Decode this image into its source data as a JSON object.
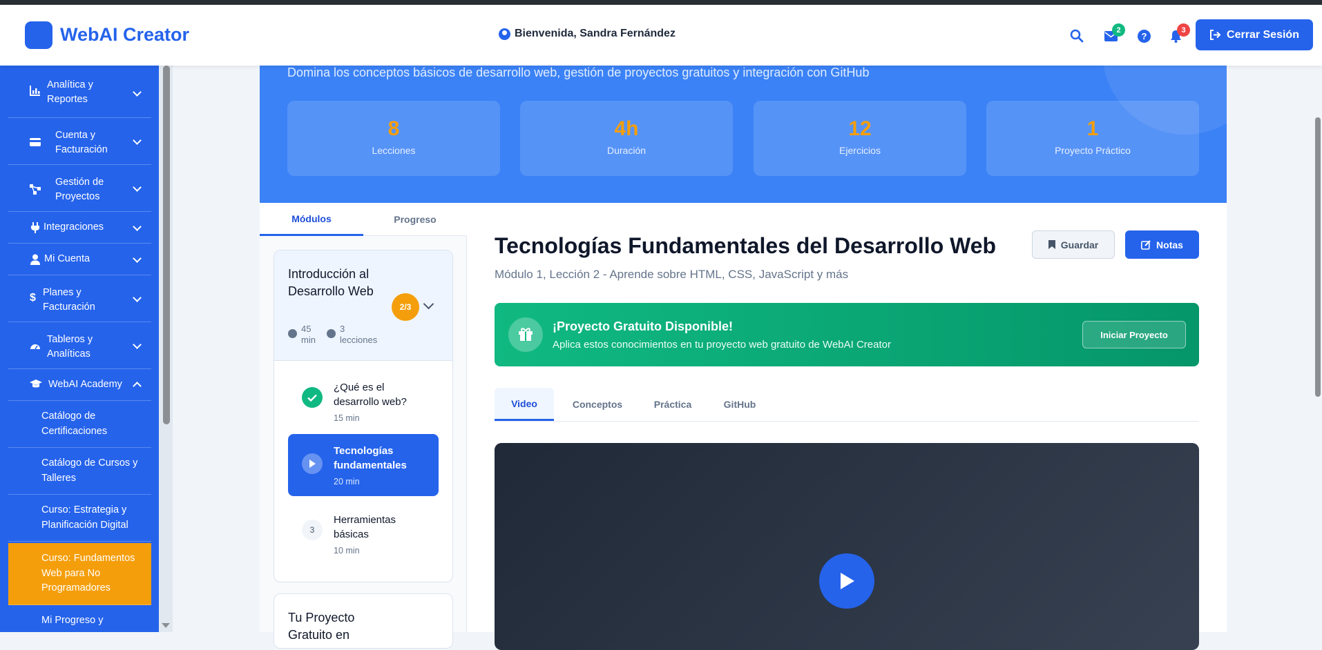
{
  "header": {
    "app_name": "WebAI Creator",
    "welcome": "Bienvenida, Sandra Fernández",
    "messages_count": "2",
    "notifications_count": "3",
    "logout_label": "Cerrar Sesión"
  },
  "sidebar": {
    "items": [
      {
        "label": "Analítica y Reportes",
        "icon": "chart-icon"
      },
      {
        "label": "Cuenta y Facturación",
        "icon": "credit-card-icon"
      },
      {
        "label": "Gestión de Proyectos",
        "icon": "project-diagram-icon"
      },
      {
        "label": "Integraciones",
        "icon": "plug-icon"
      },
      {
        "label": "Mi Cuenta",
        "icon": "user-icon"
      },
      {
        "label": "Planes y Facturación",
        "icon": "dollar-icon"
      },
      {
        "label": "Tableros y Analíticas",
        "icon": "dashboard-icon"
      },
      {
        "label": "WebAI Academy",
        "icon": "graduation-cap-icon"
      }
    ],
    "subitems": [
      {
        "label": "Catálogo de Certificaciones"
      },
      {
        "label": "Catálogo de Cursos y Talleres"
      },
      {
        "label": "Curso: Estrategia y Planificación Digital"
      },
      {
        "label": "Curso: Fundamentos Web para No Programadores"
      },
      {
        "label": "Mi Progreso y"
      }
    ]
  },
  "hero": {
    "description": "Domina los conceptos básicos de desarrollo web, gestión de proyectos gratuitos y integración con GitHub",
    "stats": [
      {
        "value": "8",
        "label": "Lecciones"
      },
      {
        "value": "4h",
        "label": "Duración"
      },
      {
        "value": "12",
        "label": "Ejercicios"
      },
      {
        "value": "1",
        "label": "Proyecto Práctico"
      }
    ]
  },
  "left_panel": {
    "tabs": [
      "Módulos",
      "Progreso"
    ],
    "module": {
      "title": "Introducción al Desarrollo Web",
      "progress": "2/3",
      "duration_value": "45",
      "duration_unit": "min",
      "lessons_value": "3",
      "lessons_unit": "lecciones"
    },
    "lessons": [
      {
        "title": "¿Qué es el desarrollo web?",
        "time": "15 min",
        "status": "completed"
      },
      {
        "title": "Tecnologías fundamentales",
        "time": "20 min",
        "status": "active"
      },
      {
        "title": "Herramientas básicas",
        "time": "10 min",
        "status": "pending",
        "number": "3"
      }
    ],
    "project_card_title": "Tu Proyecto Gratuito en"
  },
  "content": {
    "title": "Tecnologías Fundamentales del Desarrollo Web",
    "subtitle": "Módulo 1, Lección 2 - Aprende sobre HTML, CSS, JavaScript y más",
    "save_label": "Guardar",
    "notes_label": "Notas",
    "banner": {
      "title": "¡Proyecto Gratuito Disponible!",
      "text": "Aplica estos conocimientos en tu proyecto web gratuito de WebAI Creator",
      "button": "Iniciar Proyecto"
    },
    "tabs": [
      "Video",
      "Conceptos",
      "Práctica",
      "GitHub"
    ]
  },
  "colors": {
    "primary": "#2563eb",
    "accent": "#f59e0b",
    "success": "#10b981",
    "badge_green": "#10b981",
    "badge_red": "#ef4444"
  }
}
